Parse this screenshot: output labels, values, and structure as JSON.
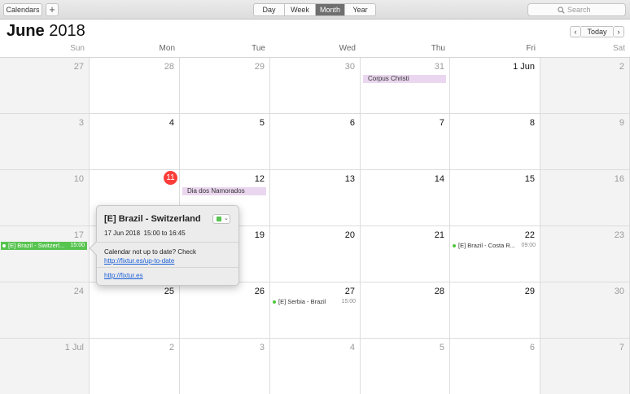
{
  "toolbar": {
    "calendars_label": "Calendars",
    "add_label": "+",
    "views": [
      {
        "label": "Day",
        "active": false
      },
      {
        "label": "Week",
        "active": false
      },
      {
        "label": "Month",
        "active": true
      },
      {
        "label": "Year",
        "active": false
      }
    ],
    "search_placeholder": "Search"
  },
  "header": {
    "month": "June",
    "year": "2018",
    "prev_label": "‹",
    "today_label": "Today",
    "next_label": "›"
  },
  "weekdays": [
    "Sun",
    "Mon",
    "Tue",
    "Wed",
    "Thu",
    "Fri",
    "Sat"
  ],
  "weeks": [
    [
      "27",
      "28",
      "29",
      "30",
      "31",
      "1 Jun",
      "2"
    ],
    [
      "3",
      "4",
      "5",
      "6",
      "7",
      "8",
      "9"
    ],
    [
      "10",
      "11",
      "12",
      "13",
      "14",
      "15",
      "16"
    ],
    [
      "17",
      "18",
      "19",
      "20",
      "21",
      "22",
      "23"
    ],
    [
      "24",
      "25",
      "26",
      "27",
      "28",
      "29",
      "30"
    ],
    [
      "1 Jul",
      "2",
      "3",
      "4",
      "5",
      "6",
      "7"
    ]
  ],
  "today": {
    "label": "11",
    "color": "#fc3d39"
  },
  "holidays": [
    {
      "title": "Corpus Christi",
      "week": 0,
      "day": 4
    },
    {
      "title": "Dia dos Namorados",
      "week": 2,
      "day": 2
    }
  ],
  "events": [
    {
      "title": "[E] Brazil - Switzerl...",
      "time": "15:00",
      "week": 3,
      "day": 0,
      "selected": true
    },
    {
      "title": "[E] Brazil - Costa R...",
      "time": "09:00",
      "week": 3,
      "day": 5,
      "selected": false
    },
    {
      "title": "[E] Serbia - Brazil",
      "time": "15:00",
      "week": 4,
      "day": 3,
      "selected": false
    }
  ],
  "popover": {
    "title": "[E] Brazil - Switzerland",
    "date": "17 Jun 2018",
    "time_range": "15:00 to 16:45",
    "note_prefix": "Calendar not up to date? Check ",
    "note_link": "http://fixtur.es/up-to-date",
    "link": "http://fixtur.es"
  },
  "colors": {
    "event_green": "#57c450",
    "holiday_purple": "#ead7ef",
    "today_red": "#fc3d39"
  }
}
